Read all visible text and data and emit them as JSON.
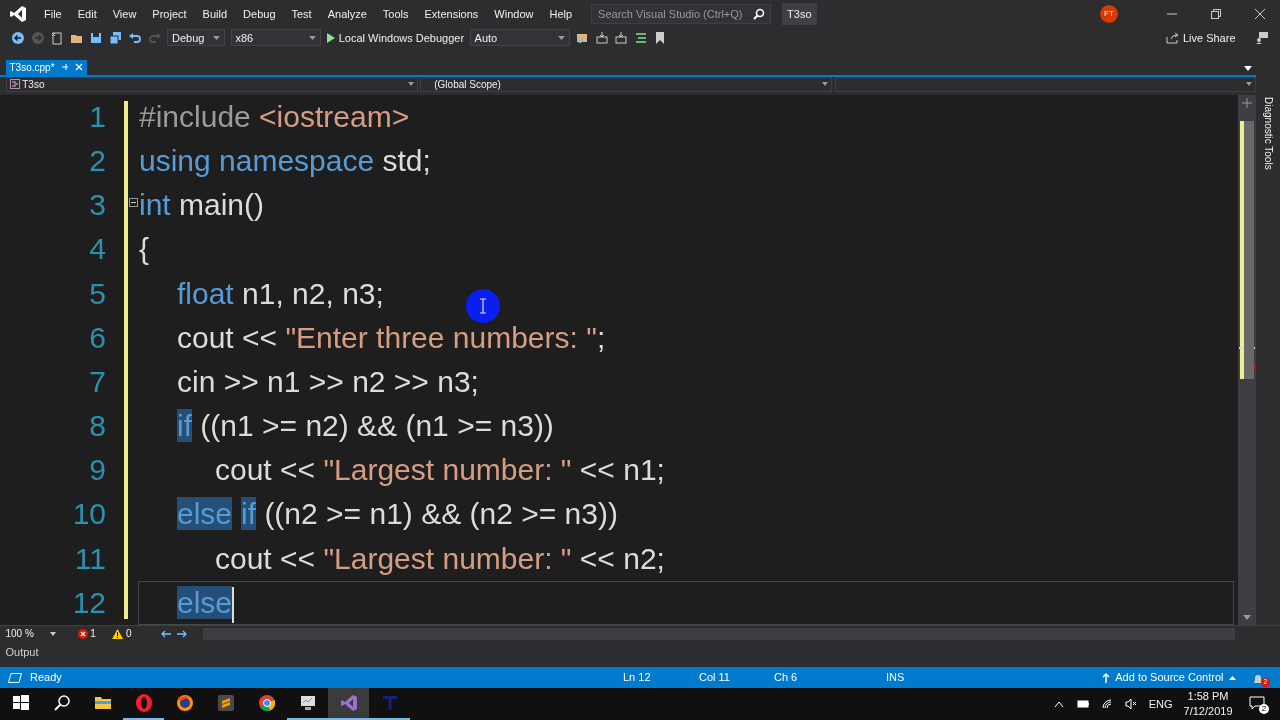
{
  "menu": [
    "File",
    "Edit",
    "View",
    "Project",
    "Build",
    "Debug",
    "Test",
    "Analyze",
    "Tools",
    "Extensions",
    "Window",
    "Help"
  ],
  "search": {
    "placeholder": "Search Visual Studio (Ctrl+Q)"
  },
  "solution_name": "T3so",
  "account": {
    "initials": "FT"
  },
  "toolbar": {
    "configuration": "Debug",
    "platform": "x86",
    "debugger": "Local Windows Debugger",
    "target": "Auto",
    "live_share": "Live Share"
  },
  "tabs": [
    {
      "label": "T3so.cpp*",
      "selected": true
    }
  ],
  "navigation": {
    "project": "T3so",
    "scope": "(Global Scope)"
  },
  "side_panel": "Diagnostic Tools",
  "code_lines": [
    {
      "number": "1",
      "fold": false,
      "current": false,
      "tokens": [
        {
          "kind": "directive",
          "text": "#include "
        },
        {
          "kind": "string",
          "text": "<iostream>"
        }
      ]
    },
    {
      "number": "2",
      "fold": false,
      "current": false,
      "tokens": [
        {
          "kind": "keyword",
          "text": "using namespace"
        },
        {
          "kind": "text",
          "text": " std;"
        }
      ]
    },
    {
      "number": "3",
      "fold": true,
      "current": false,
      "tokens": [
        {
          "kind": "keyword",
          "text": "int"
        },
        {
          "kind": "text",
          "text": " main()"
        }
      ]
    },
    {
      "number": "4",
      "fold": false,
      "current": false,
      "tokens": [
        {
          "kind": "text",
          "text": "{"
        }
      ],
      "children": [
        {
          "number": "5",
          "fold": false,
          "current": false,
          "tokens": [
            {
              "kind": "keyword",
              "text": "float"
            },
            {
              "kind": "text",
              "text": " n1, n2, n3;"
            }
          ]
        },
        {
          "number": "6",
          "fold": false,
          "current": false,
          "tokens": [
            {
              "kind": "text",
              "text": "cout << "
            },
            {
              "kind": "string",
              "text": "\"Enter three numbers: \""
            },
            {
              "kind": "text",
              "text": ";"
            }
          ]
        },
        {
          "number": "7",
          "fold": false,
          "current": false,
          "tokens": [
            {
              "kind": "text",
              "text": "cin >> n1 >> n2 >> n3;"
            }
          ]
        },
        {
          "number": "8",
          "fold": false,
          "current": false,
          "tokens": [
            {
              "kind": "highlight",
              "text": "if"
            },
            {
              "kind": "text",
              "text": " ((n1 >= n2) && (n1 >= n3))"
            }
          ],
          "children": [
            {
              "number": "9",
              "fold": false,
              "current": false,
              "tokens": [
                {
                  "kind": "text",
                  "text": "cout << "
                },
                {
                  "kind": "string",
                  "text": "\"Largest number: \""
                },
                {
                  "kind": "text",
                  "text": " << n1;"
                }
              ]
            }
          ]
        },
        {
          "number": "10",
          "fold": false,
          "current": false,
          "tokens": [
            {
              "kind": "highlight",
              "text": "else"
            },
            {
              "kind": "highlight",
              "text": "if"
            },
            {
              "kind": "text",
              "text": " ((n2 >= n1) && (n2 >= n3))"
            }
          ],
          "children": [
            {
              "number": "11",
              "fold": false,
              "current": false,
              "tokens": [
                {
                  "kind": "text",
                  "text": "cout << "
                },
                {
                  "kind": "string",
                  "text": "\"Largest number: \""
                },
                {
                  "kind": "text",
                  "text": " << n2;"
                }
              ]
            }
          ]
        },
        {
          "number": "12",
          "fold": false,
          "current": true,
          "tokens": [
            {
              "kind": "highlight",
              "text": "else"
            }
          ]
        }
      ]
    }
  ],
  "editor_footer": {
    "zoom": "100 %",
    "errors": "1",
    "warnings": "0"
  },
  "output_panel": "Output",
  "status_bar": {
    "state": "Ready",
    "line": "Ln 12",
    "column": "Col 11",
    "char": "Ch 6",
    "mode": "INS",
    "source_control": "Add to Source Control",
    "notifications": "2"
  },
  "taskbar": {
    "apps": [
      {
        "kind": "explorer",
        "running": false,
        "selected": false
      },
      {
        "kind": "opera",
        "running": true,
        "selected": false
      },
      {
        "kind": "firefox",
        "running": false,
        "selected": false
      },
      {
        "kind": "sublime",
        "running": false,
        "selected": false
      },
      {
        "kind": "chrome",
        "running": false,
        "selected": false
      },
      {
        "kind": "monitor",
        "running": true,
        "selected": false
      },
      {
        "kind": "visualstudio",
        "running": true,
        "selected": true
      },
      {
        "kind": "letter",
        "running": true,
        "selected": false
      }
    ],
    "language": "ENG",
    "time": "1:58 PM",
    "date": "7/12/2019",
    "action_center_count": "2"
  }
}
